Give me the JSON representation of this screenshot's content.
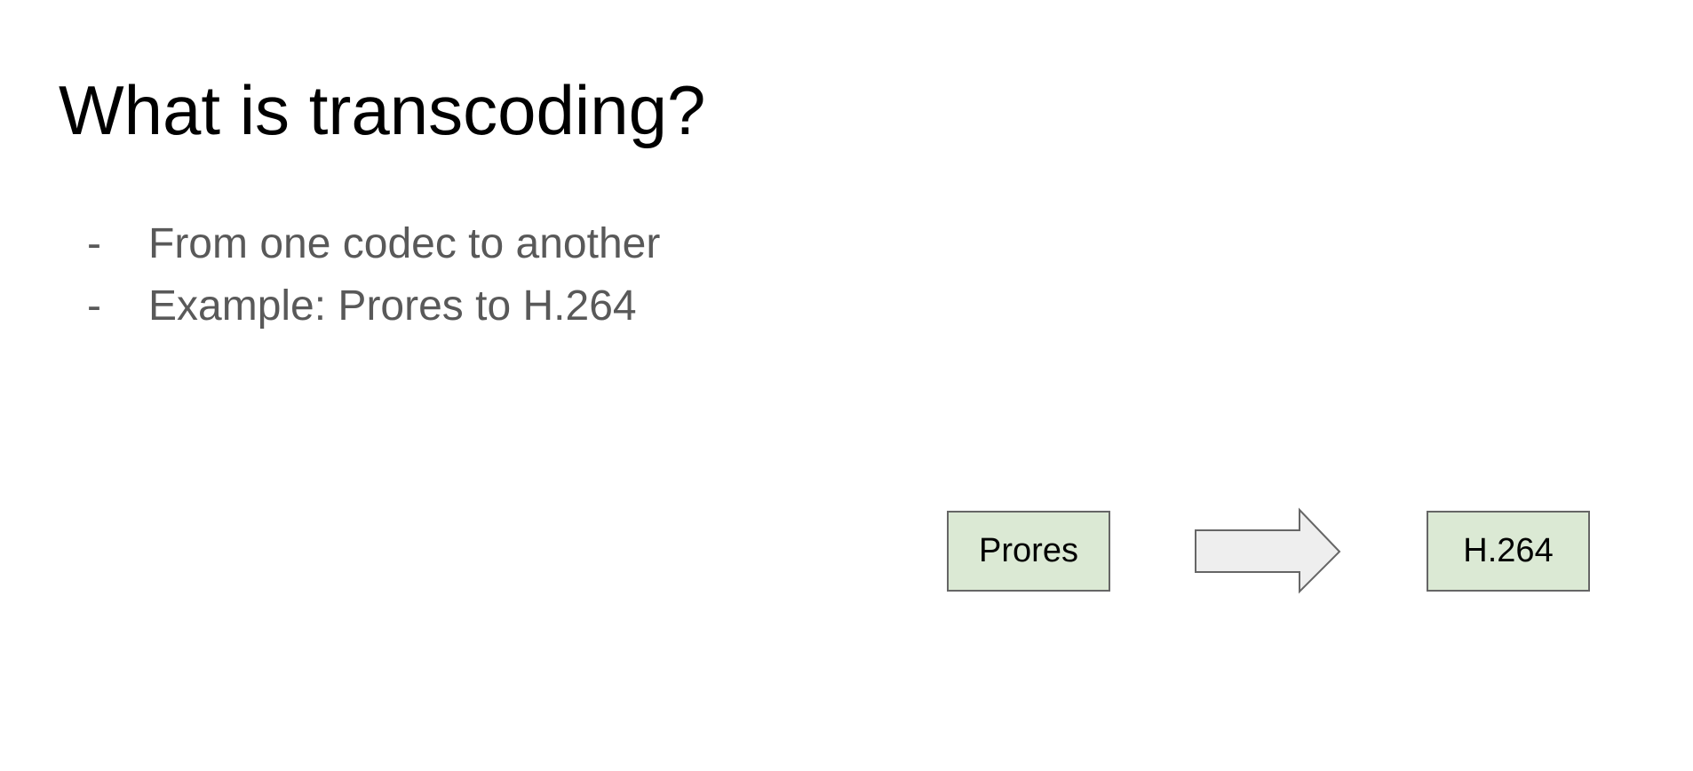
{
  "slide": {
    "title": "What is transcoding?",
    "bullets": [
      {
        "marker": "-",
        "text": "From one codec to another"
      },
      {
        "marker": "-",
        "text": "Example: Prores to H.264"
      }
    ]
  },
  "diagram": {
    "source_box": {
      "label": "Prores"
    },
    "target_box": {
      "label": "H.264"
    },
    "colors": {
      "box_fill": "#dbe9d4",
      "box_stroke": "#666666",
      "arrow_fill": "#eeeeee",
      "arrow_stroke": "#666666",
      "title_text": "#000000",
      "bullet_text": "#595959"
    }
  }
}
